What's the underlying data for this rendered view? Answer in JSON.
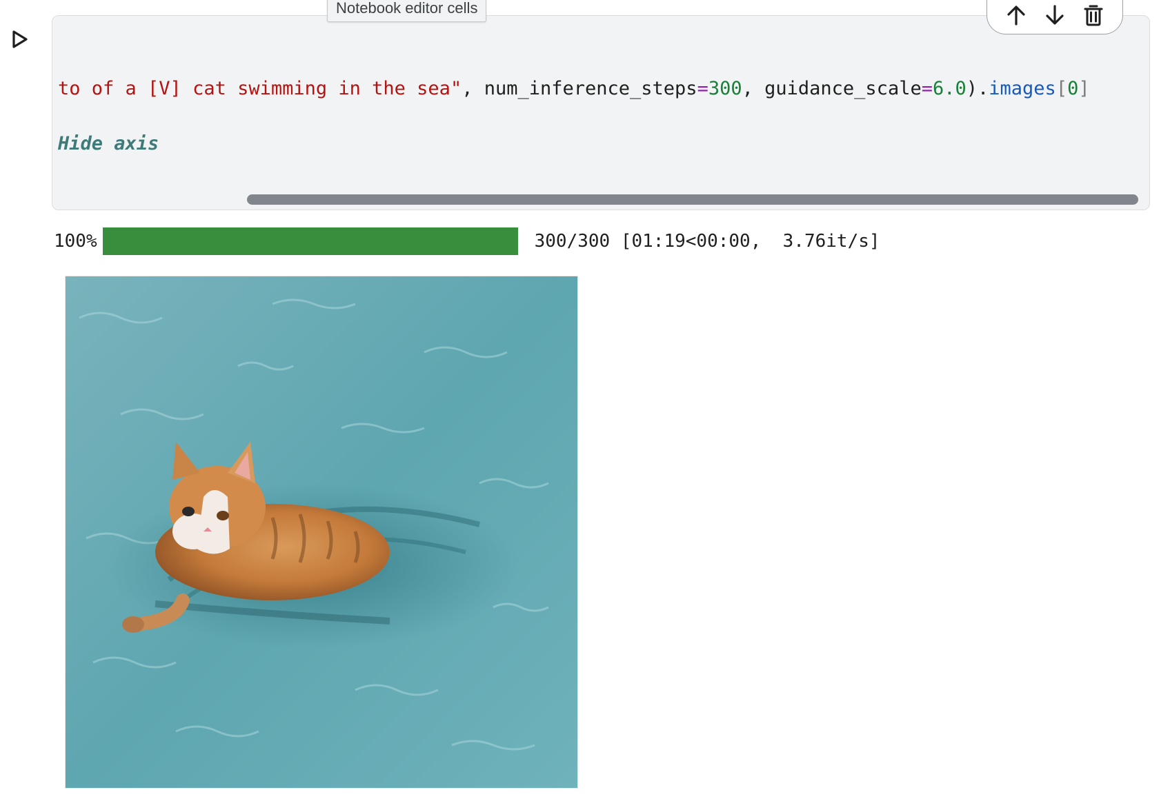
{
  "cell": {
    "code_lines": [
      {
        "tokens": [
          {
            "text": "to of a [V] cat swimming in the sea\"",
            "kind": "str"
          },
          {
            "text": ", num_inference_steps",
            "kind": "plain"
          },
          {
            "text": "=",
            "kind": "op"
          },
          {
            "text": "300",
            "kind": "num"
          },
          {
            "text": ", guidance_scale",
            "kind": "plain"
          },
          {
            "text": "=",
            "kind": "op"
          },
          {
            "text": "6.0",
            "kind": "num"
          },
          {
            "text": ").",
            "kind": "plain"
          },
          {
            "text": "images",
            "kind": "attr"
          },
          {
            "text": "[",
            "kind": "bracket"
          },
          {
            "text": "0",
            "kind": "num"
          },
          {
            "text": "]",
            "kind": "bracket"
          }
        ]
      },
      {
        "tokens": [
          {
            "text": "Hide axis",
            "kind": "comment"
          }
        ]
      }
    ],
    "tooltip": "Notebook editor cells",
    "toolbar": {
      "move_up_icon": "arrow-up-icon",
      "move_down_icon": "arrow-down-icon",
      "delete_icon": "trash-icon"
    },
    "run_icon": "play-icon"
  },
  "output": {
    "progress": {
      "percent_label": "100%",
      "fraction": 1.0,
      "stats": "300/300 [01:19<00:00,  3.76it/s]",
      "fill_color": "#388e3c"
    },
    "image_subject": "cat-swimming-in-sea"
  }
}
